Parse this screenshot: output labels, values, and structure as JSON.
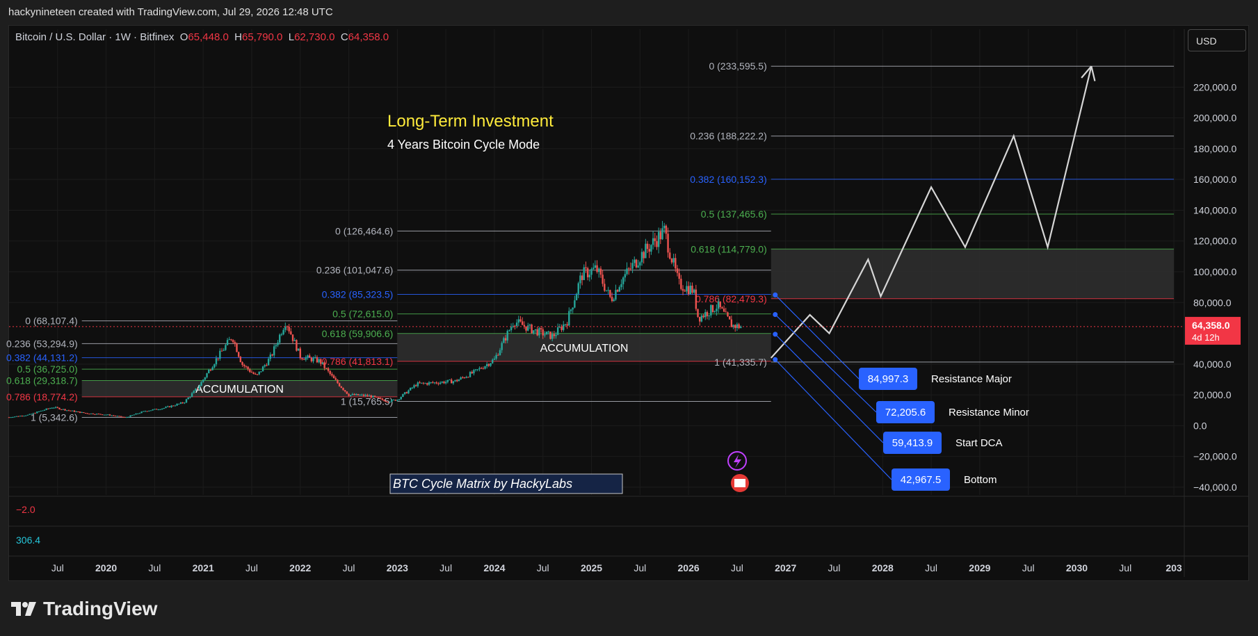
{
  "header": {
    "credit": "hackynineteen created with TradingView.com, Jul 29, 2026 12:48 UTC"
  },
  "symbol": {
    "name": "Bitcoin / U.S. Dollar · 1W · Bitfinex",
    "o_label": "O",
    "o_value": "65,448.0",
    "h_label": "H",
    "h_value": "65,790.0",
    "l_label": "L",
    "l_value": "62,730.0",
    "c_label": "C",
    "c_value": "64,358.0"
  },
  "currency_button": "USD",
  "footer": {
    "brand": "TradingView"
  },
  "colors": {
    "up": "#26a69a",
    "down": "#ef5350",
    "gray": "#b2b5be",
    "blue": "#2962ff",
    "green": "#4caf50",
    "pink": "#f23645",
    "yellow": "#ffeb3b",
    "cyan": "#26c6da"
  },
  "chart_data": {
    "type": "candlestick",
    "title": "Long-Term Investment",
    "subtitle": "4 Years Bitcoin Cycle Mode",
    "watermark_label": "BTC Cycle Matrix by HackyLabs",
    "ylim": [
      -45000,
      245000
    ],
    "y_ticks": [
      "220,000.0",
      "200,000.0",
      "180,000.0",
      "160,000.0",
      "140,000.0",
      "120,000.0",
      "100,000.0",
      "80,000.0",
      "40,000.0",
      "20,000.0",
      "0.0",
      "−20,000.0",
      "−40,000.0"
    ],
    "y_tick_values": [
      220000,
      200000,
      180000,
      160000,
      140000,
      120000,
      100000,
      80000,
      40000,
      20000,
      0,
      -20000,
      -40000
    ],
    "x_ticks": [
      "Jul",
      "2020",
      "Jul",
      "2021",
      "Jul",
      "2022",
      "Jul",
      "2023",
      "Jul",
      "2024",
      "Jul",
      "2025",
      "Jul",
      "2026",
      "Jul",
      "2027",
      "Jul",
      "2028",
      "Jul",
      "2029",
      "Jul",
      "2030",
      "Jul",
      "203"
    ],
    "x_tick_values": [
      2019.5,
      2020.0,
      2020.5,
      2021.0,
      2021.5,
      2022.0,
      2022.5,
      2023.0,
      2023.5,
      2024.0,
      2024.5,
      2025.0,
      2025.5,
      2026.0,
      2026.5,
      2027.0,
      2027.5,
      2028.0,
      2028.5,
      2029.0,
      2029.5,
      2030.0,
      2030.5,
      2031.0
    ],
    "last_price": {
      "value": 64358,
      "label": "64,358.0",
      "countdown": "4d 12h"
    },
    "price_path": [
      [
        2019.0,
        5500
      ],
      [
        2019.2,
        7000
      ],
      [
        2019.45,
        12000
      ],
      [
        2019.6,
        10000
      ],
      [
        2019.8,
        8000
      ],
      [
        2020.0,
        7200
      ],
      [
        2020.2,
        5342.6
      ],
      [
        2020.4,
        9500
      ],
      [
        2020.6,
        11500
      ],
      [
        2020.8,
        15000
      ],
      [
        2020.95,
        25000
      ],
      [
        2021.1,
        40000
      ],
      [
        2021.3,
        58000
      ],
      [
        2021.4,
        40000
      ],
      [
        2021.55,
        32000
      ],
      [
        2021.7,
        45000
      ],
      [
        2021.85,
        68107.4
      ],
      [
        2022.0,
        45000
      ],
      [
        2022.2,
        42000
      ],
      [
        2022.35,
        30000
      ],
      [
        2022.5,
        20000
      ],
      [
        2022.7,
        19500
      ],
      [
        2022.9,
        15765.5
      ],
      [
        2023.0,
        17000
      ],
      [
        2023.2,
        27000
      ],
      [
        2023.4,
        28000
      ],
      [
        2023.6,
        29000
      ],
      [
        2023.8,
        35000
      ],
      [
        2024.0,
        43000
      ],
      [
        2024.2,
        68000
      ],
      [
        2024.4,
        62000
      ],
      [
        2024.6,
        58000
      ],
      [
        2024.75,
        68000
      ],
      [
        2024.9,
        98000
      ],
      [
        2025.05,
        102000
      ],
      [
        2025.2,
        82000
      ],
      [
        2025.3,
        94000
      ],
      [
        2025.5,
        110000
      ],
      [
        2025.75,
        126464.6
      ],
      [
        2025.9,
        92000
      ],
      [
        2026.05,
        88000
      ],
      [
        2026.1,
        70000
      ],
      [
        2026.3,
        78000
      ],
      [
        2026.45,
        65000
      ],
      [
        2026.55,
        64358
      ]
    ],
    "projection_path": [
      [
        2026.85,
        44000
      ],
      [
        2027.25,
        72000
      ],
      [
        2027.45,
        60000
      ],
      [
        2027.85,
        108000
      ],
      [
        2027.98,
        84000
      ],
      [
        2028.5,
        155000
      ],
      [
        2028.85,
        116000
      ],
      [
        2029.35,
        188222.2
      ],
      [
        2029.7,
        116000
      ],
      [
        2030.15,
        233595.5
      ]
    ],
    "fib_sets": [
      {
        "x_start": 2019.75,
        "x_end": 2023.0,
        "levels": [
          {
            "label": "0 (68,107.4)",
            "price": 68107.4,
            "color": "gray"
          },
          {
            "label": "0.236 (53,294.9)",
            "price": 53294.9,
            "color": "gray"
          },
          {
            "label": "0.382 (44,131.2)",
            "price": 44131.2,
            "color": "blue"
          },
          {
            "label": "0.5 (36,725.0)",
            "price": 36725.0,
            "color": "green"
          },
          {
            "label": "0.618 (29,318.7)",
            "price": 29318.7,
            "color": "green"
          },
          {
            "label": "0.786 (18,774.2)",
            "price": 18774.2,
            "color": "pink"
          },
          {
            "label": "1 (5,342.6)",
            "price": 5342.6,
            "color": "gray"
          }
        ]
      },
      {
        "x_start": 2023.0,
        "x_end": 2026.85,
        "levels": [
          {
            "label": "0 (126,464.6)",
            "price": 126464.6,
            "color": "gray"
          },
          {
            "label": "0.236 (101,047.6)",
            "price": 101047.6,
            "color": "gray"
          },
          {
            "label": "0.382 (85,323.5)",
            "price": 85323.5,
            "color": "blue"
          },
          {
            "label": "0.5 (72,615.0)",
            "price": 72615.0,
            "color": "green"
          },
          {
            "label": "0.618 (59,906.6)",
            "price": 59906.6,
            "color": "green"
          },
          {
            "label": "0.786 (41,813.1)",
            "price": 41813.1,
            "color": "pink"
          },
          {
            "label": "1 (15,765.5)",
            "price": 15765.5,
            "color": "gray"
          }
        ]
      },
      {
        "x_start": 2026.85,
        "x_end": 2031.0,
        "levels": [
          {
            "label": "0 (233,595.5)",
            "price": 233595.5,
            "color": "gray"
          },
          {
            "label": "0.236 (188,222.2)",
            "price": 188222.2,
            "color": "gray"
          },
          {
            "label": "0.382 (160,152.3)",
            "price": 160152.3,
            "color": "blue"
          },
          {
            "label": "0.5 (137,465.6)",
            "price": 137465.6,
            "color": "green"
          },
          {
            "label": "0.618 (114,779.0)",
            "price": 114779.0,
            "color": "green"
          },
          {
            "label": "0.786 (82,479.3)",
            "price": 82479.3,
            "color": "pink"
          },
          {
            "label": "1 (41,335.7)",
            "price": 41335.7,
            "color": "gray"
          }
        ]
      }
    ],
    "zones": [
      {
        "label": "ACCUMULATION",
        "x_start": 2019.75,
        "x_end": 2023.0,
        "top": 29318.7,
        "bottom": 18774.2
      },
      {
        "label": "ACCUMULATION",
        "x_start": 2023.0,
        "x_end": 2026.85,
        "top": 59906.6,
        "bottom": 41813.1
      },
      {
        "label": "",
        "x_start": 2026.85,
        "x_end": 2031.0,
        "top": 114779.0,
        "bottom": 82479.3
      }
    ],
    "targets": [
      {
        "value_label": "84,997.3",
        "name": "Resistance Major",
        "price": 84997.3
      },
      {
        "value_label": "72,205.6",
        "name": "Resistance Minor",
        "price": 72205.6
      },
      {
        "value_label": "59,413.9",
        "name": "Start DCA",
        "price": 59413.9
      },
      {
        "value_label": "42,967.5",
        "name": "Bottom",
        "price": 42967.5
      }
    ],
    "indicators": [
      {
        "label": "−2.0",
        "color": "pink"
      },
      {
        "label": "306.4",
        "color": "cyan"
      }
    ]
  }
}
